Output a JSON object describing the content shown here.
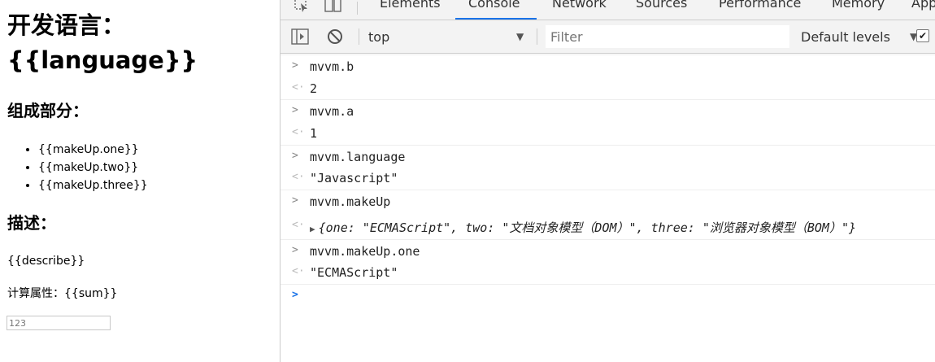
{
  "page": {
    "title_label": "开发语言：",
    "title_value": "{{language}}",
    "section_composition": "组成部分：",
    "list_items": [
      "{{makeUp.one}}",
      "{{makeUp.two}}",
      "{{makeUp.three}}"
    ],
    "section_description": "描述：",
    "describe": "{{describe}}",
    "computed_label": "计算属性：{{sum}}",
    "input_value": "123"
  },
  "devtools": {
    "tabs": [
      "Elements",
      "Console",
      "Network",
      "Sources",
      "Performance",
      "Memory",
      "App"
    ],
    "active_tab": "Console",
    "context": "top",
    "filter_placeholder": "Filter",
    "levels": "Default levels",
    "console_rows": [
      {
        "kind": "input",
        "text": "mvvm.b"
      },
      {
        "kind": "result",
        "text": "2"
      },
      {
        "kind": "input",
        "text": "mvvm.a"
      },
      {
        "kind": "result",
        "text": "1"
      },
      {
        "kind": "input",
        "text": "mvvm.language"
      },
      {
        "kind": "result",
        "text": "\"Javascript\""
      },
      {
        "kind": "input",
        "text": "mvvm.makeUp"
      },
      {
        "kind": "result-object",
        "text": "{one: \"ECMAScript\", two: \"文档对象模型（DOM）\", three: \"浏览器对象模型（BOM）\"}"
      },
      {
        "kind": "input",
        "text": "mvvm.makeUp.one"
      },
      {
        "kind": "result",
        "text": "\"ECMAScript\""
      }
    ]
  }
}
